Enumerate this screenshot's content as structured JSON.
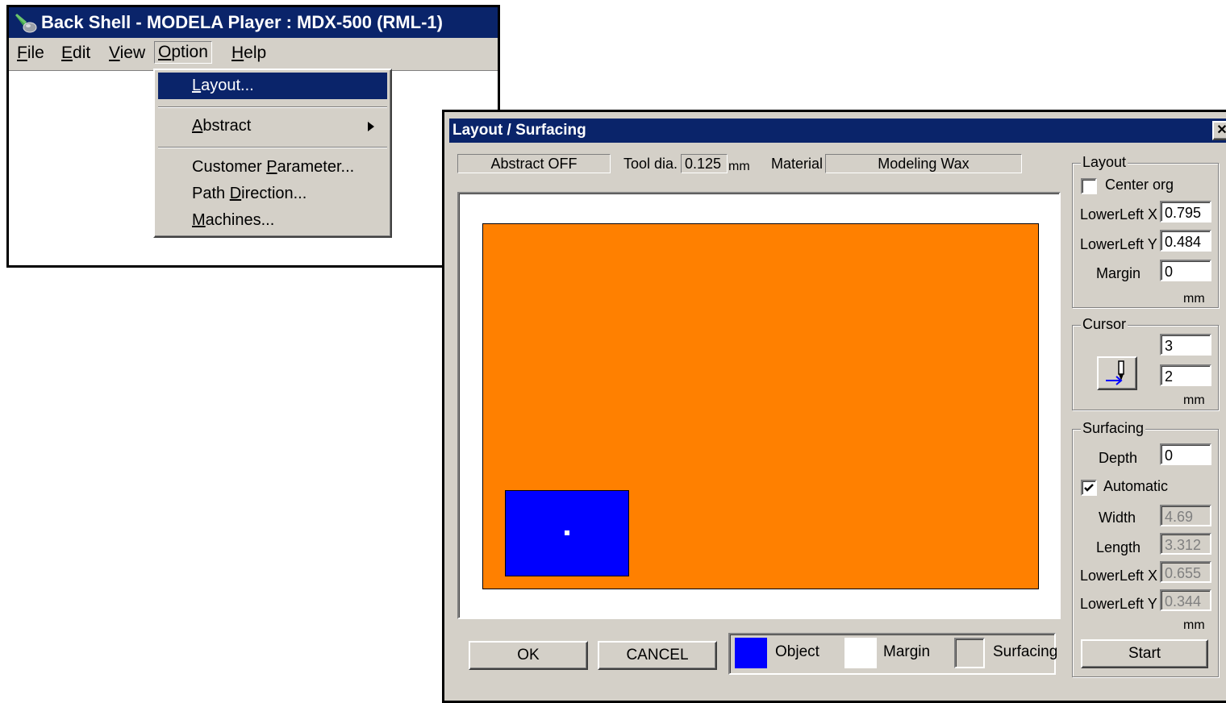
{
  "main_window": {
    "title": "Back Shell - MODELA Player  : MDX-500 (RML-1)",
    "menu": {
      "file": "File",
      "edit": "Edit",
      "view": "View",
      "option": "Option",
      "help": "Help"
    },
    "dropdown": {
      "layout": "Layout...",
      "abstract": "Abstract",
      "customer_parameter": "Customer Parameter...",
      "path_direction": "Path Direction...",
      "machines": "Machines..."
    }
  },
  "dialog": {
    "title": "Layout / Surfacing",
    "close_symbol": "✕",
    "abstract_status": "Abstract OFF",
    "tool_dia_label": "Tool dia.",
    "tool_dia_value": "0.125",
    "tool_dia_unit": "mm",
    "material_label": "Material",
    "material_value": "Modeling Wax",
    "layout_group": {
      "title": "Layout",
      "center_org_label": "Center org",
      "center_org_checked": false,
      "lowerleft_x_label": "LowerLeft X",
      "lowerleft_x_value": "0.795",
      "lowerleft_y_label": "LowerLeft Y",
      "lowerleft_y_value": "0.484",
      "margin_label": "Margin",
      "margin_value": "0",
      "unit": "mm"
    },
    "cursor_group": {
      "title": "Cursor",
      "value_1": "3",
      "value_2": "2",
      "unit": "mm"
    },
    "surfacing_group": {
      "title": "Surfacing",
      "depth_label": "Depth",
      "depth_value": "0",
      "automatic_label": "Automatic",
      "automatic_checked": true,
      "width_label": "Width",
      "width_value": "4.69",
      "length_label": "Length",
      "length_value": "3.312",
      "lowerleft_x_label": "LowerLeft X",
      "lowerleft_x_value": "0.655",
      "lowerleft_y_label": "LowerLeft Y",
      "lowerleft_y_value": "0.344",
      "unit": "mm"
    },
    "buttons": {
      "ok": "OK",
      "cancel": "CANCEL",
      "start": "Start"
    },
    "legend": {
      "object": "Object",
      "margin": "Margin",
      "surfacing": "Surfacing"
    },
    "colors": {
      "surfacing_area": "#ff8000",
      "object": "#0000ff",
      "margin": "#ffffff",
      "title_bar": "#0a246a"
    }
  }
}
